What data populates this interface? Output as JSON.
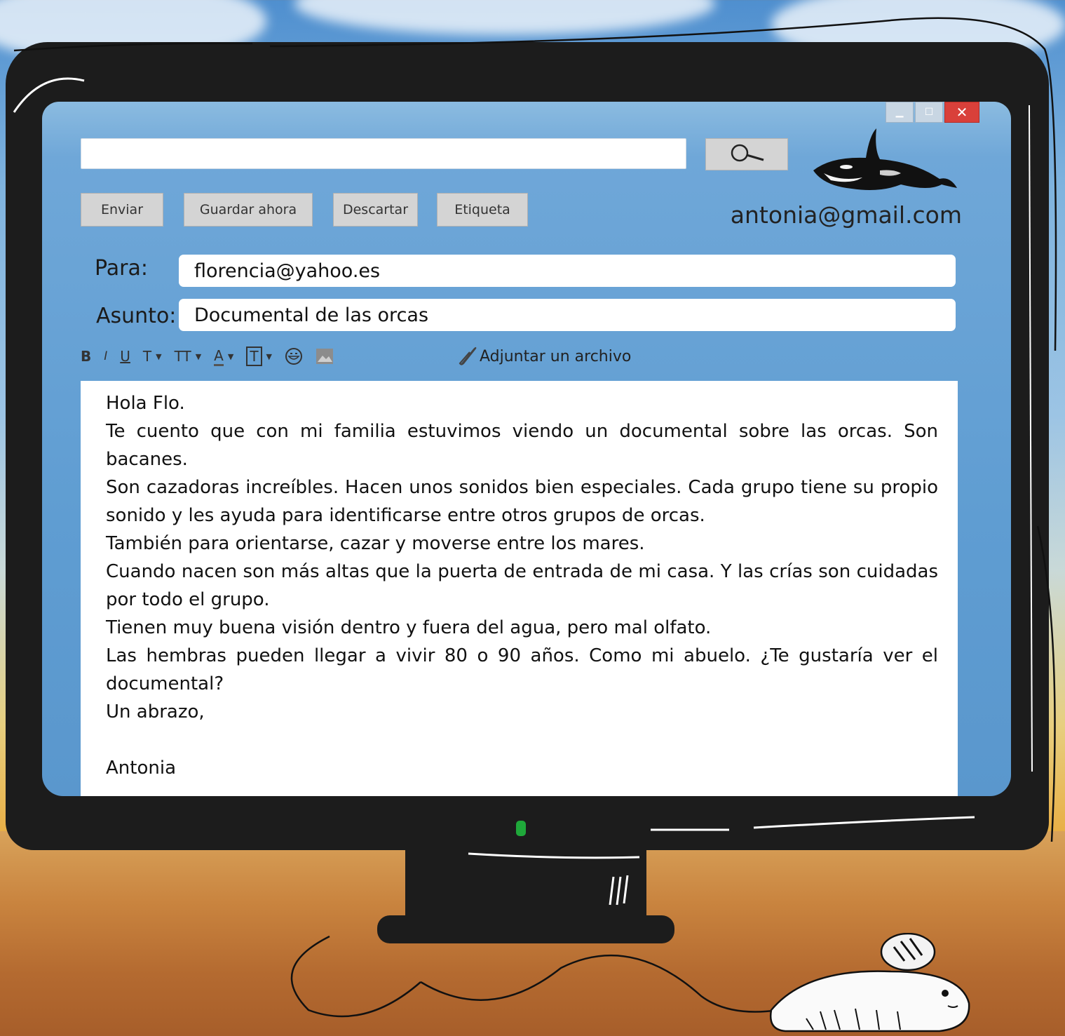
{
  "window": {
    "minimize_icon": "minimize-icon",
    "maximize_icon": "maximize-icon",
    "close_label": "✕"
  },
  "search": {
    "value": "",
    "placeholder": "",
    "button_icon": "magnifier-icon"
  },
  "toolbar": {
    "send_label": "Enviar",
    "save_label": "Guardar ahora",
    "discard_label": "Descartar",
    "label_label": "Etiqueta"
  },
  "account": {
    "email": "antonia@gmail.com",
    "logo_icon": "orca-logo-icon"
  },
  "compose": {
    "to_label": "Para:",
    "to_value": "florencia@yahoo.es",
    "subject_label": "Asunto:",
    "subject_value": "Documental de las orcas"
  },
  "format_bar": {
    "bold": "B",
    "italic": "I",
    "underline": "U",
    "font": "T",
    "size": "TT",
    "text_color": "A",
    "highlight": "T",
    "emoji_icon": "smiley-icon",
    "image_icon": "image-icon",
    "attach_label": "Adjuntar un archivo"
  },
  "message": {
    "lines": [
      "Hola Flo.",
      "Te cuento que con mi familia estuvimos viendo un documental sobre las orcas. Son bacanes.",
      "Son cazadoras increíbles. Hacen unos sonidos bien especiales. Cada grupo tiene su propio sonido y les ayuda para identificarse entre otros grupos de orcas.",
      "También para orientarse, cazar y moverse entre los mares.",
      "Cuando nacen son más altas que la puerta de entrada de mi casa. Y las crías son cuidadas por todo el grupo.",
      "Tienen muy buena visión dentro y fuera del agua, pero mal olfato.",
      "Las hembras pueden llegar a vivir 80 o 90 años. Como mi abuelo. ¿Te gustaría ver el documental?",
      "Un abrazo,"
    ],
    "signature": "Antonia",
    "highlight_color": "#e0202a"
  },
  "colors": {
    "screen": "#5f9dd2",
    "close_button": "#d9403a",
    "power_led": "#1fa83a"
  }
}
